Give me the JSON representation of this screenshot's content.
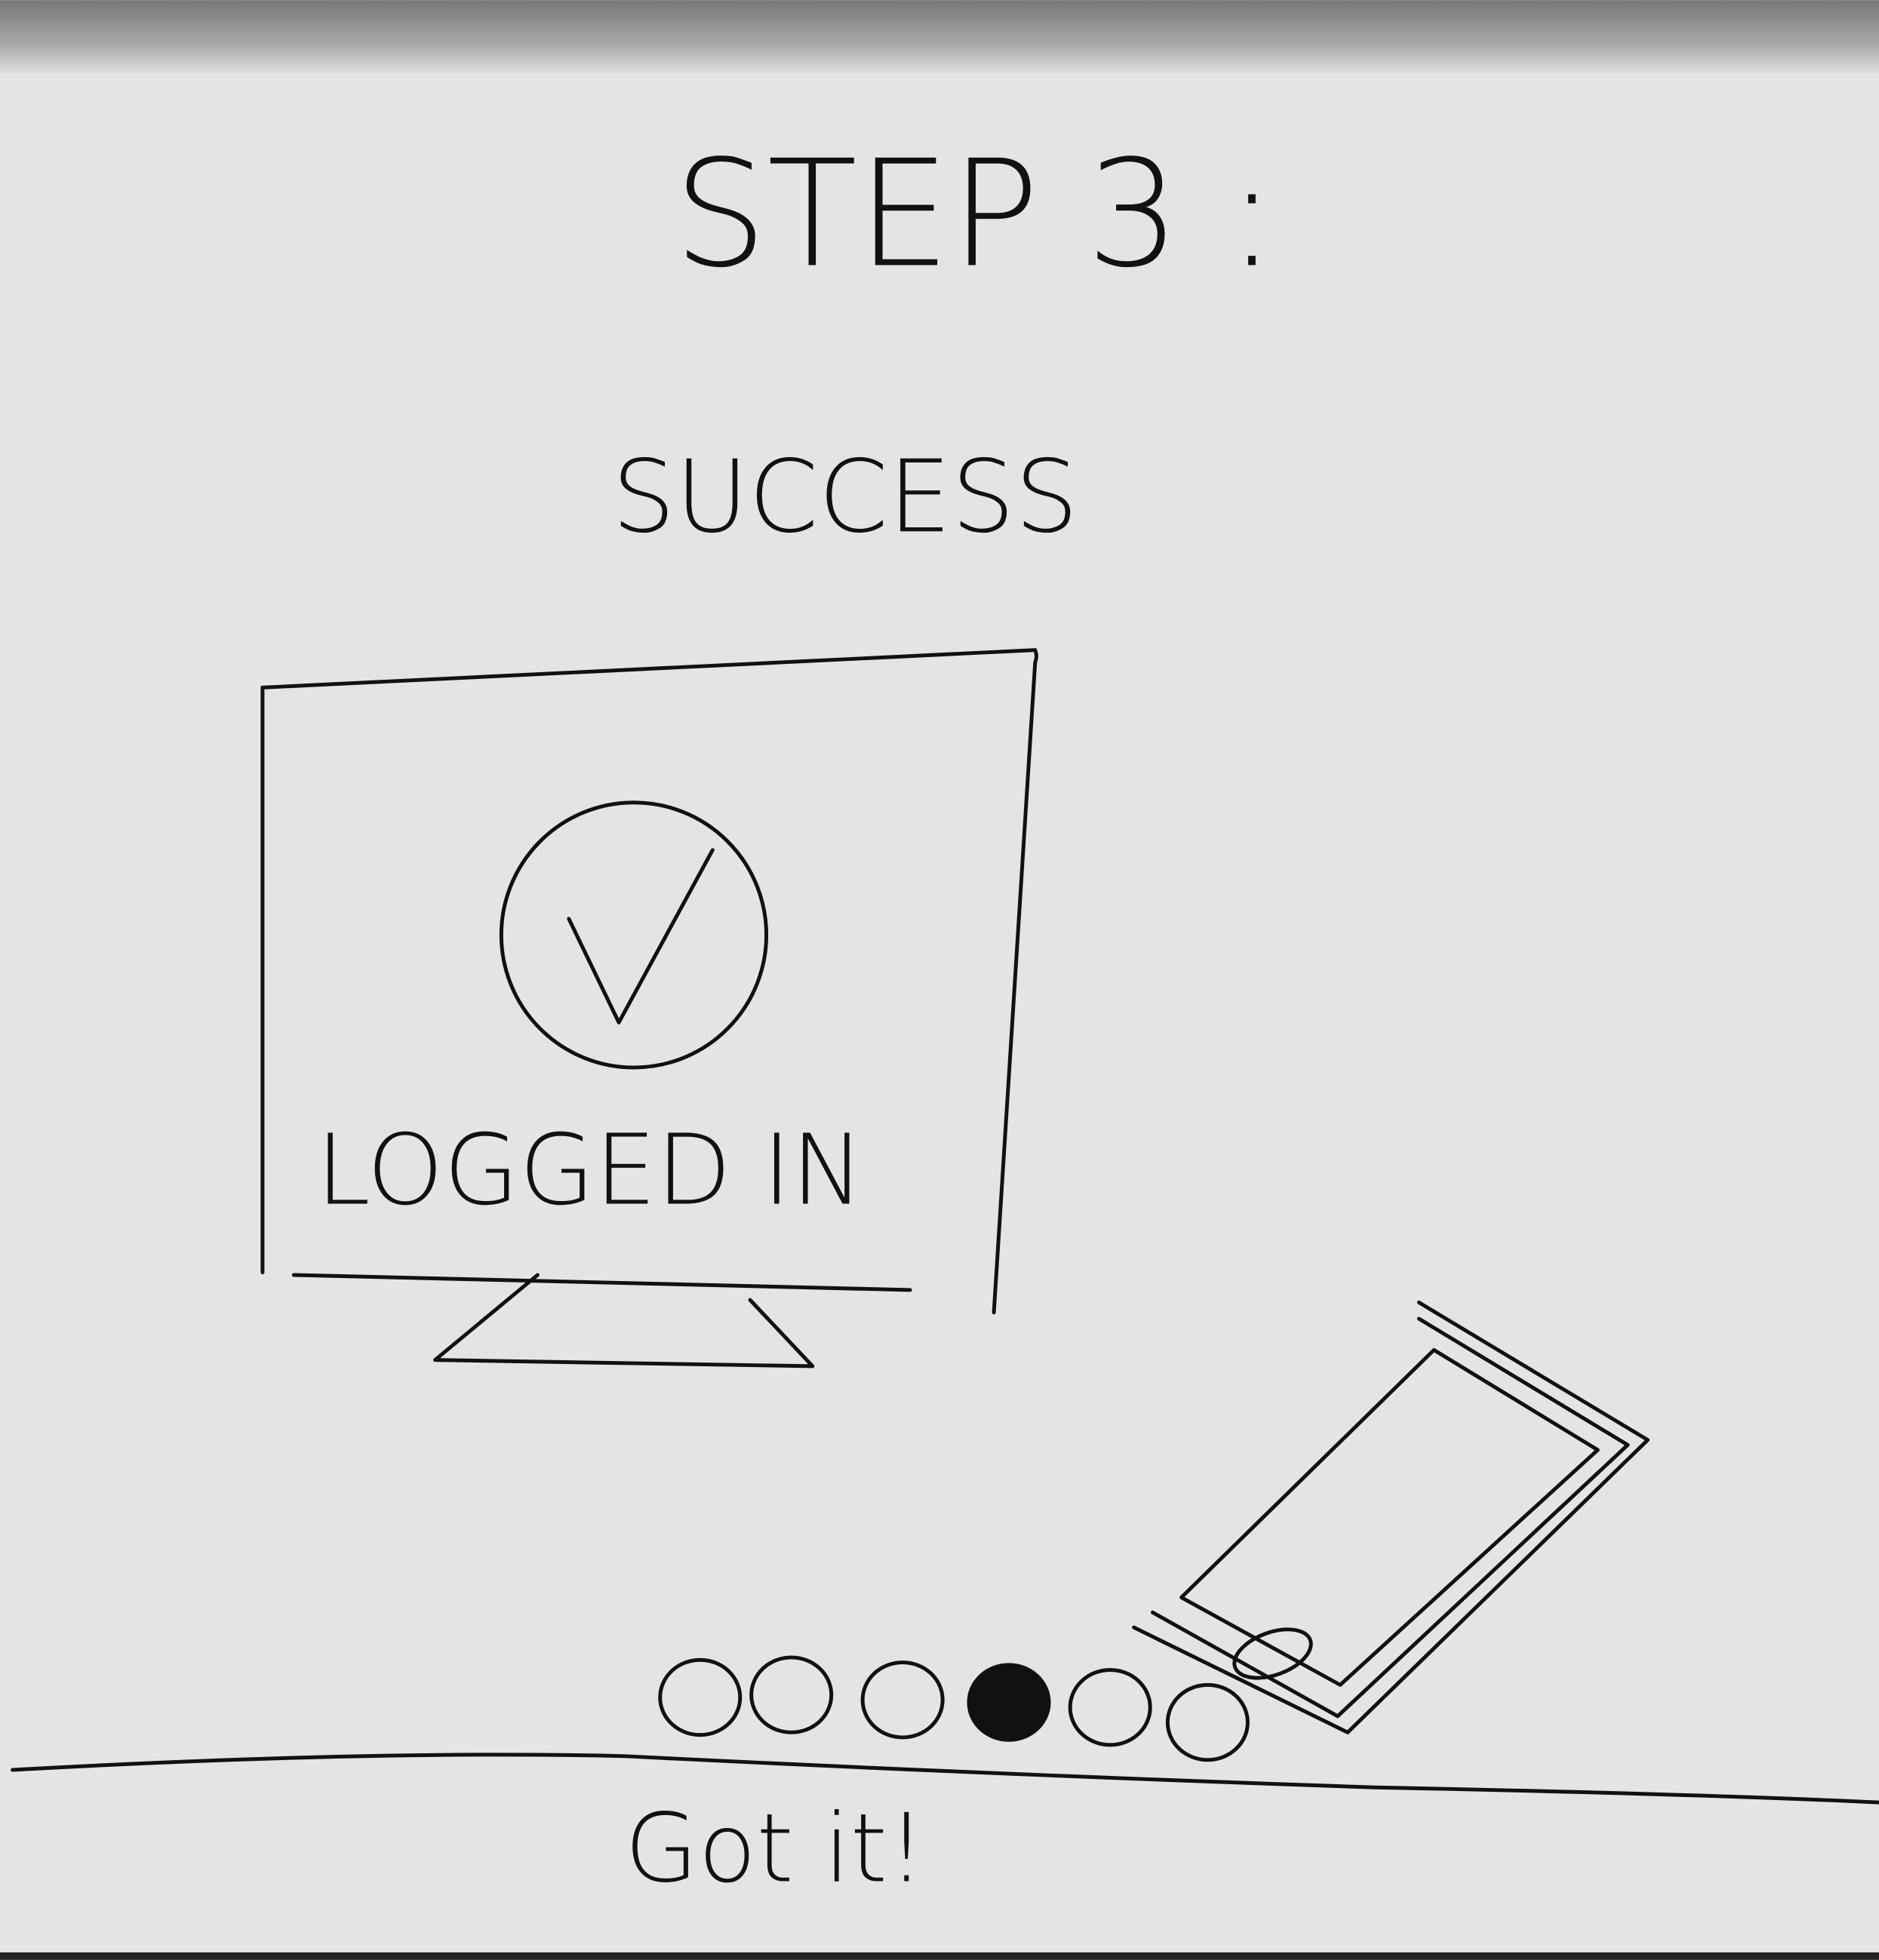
{
  "header": {
    "title": "STEP 3 :"
  },
  "main": {
    "subtitle": "SUCCESS",
    "status_label": "LOGGED IN",
    "status_icon": "checkmark-circle-icon"
  },
  "pagination": {
    "total": 6,
    "current": 4
  },
  "footer": {
    "confirm_label": "Got it!"
  },
  "colors": {
    "paper": "#e4e4e4",
    "ink": "#111111"
  }
}
